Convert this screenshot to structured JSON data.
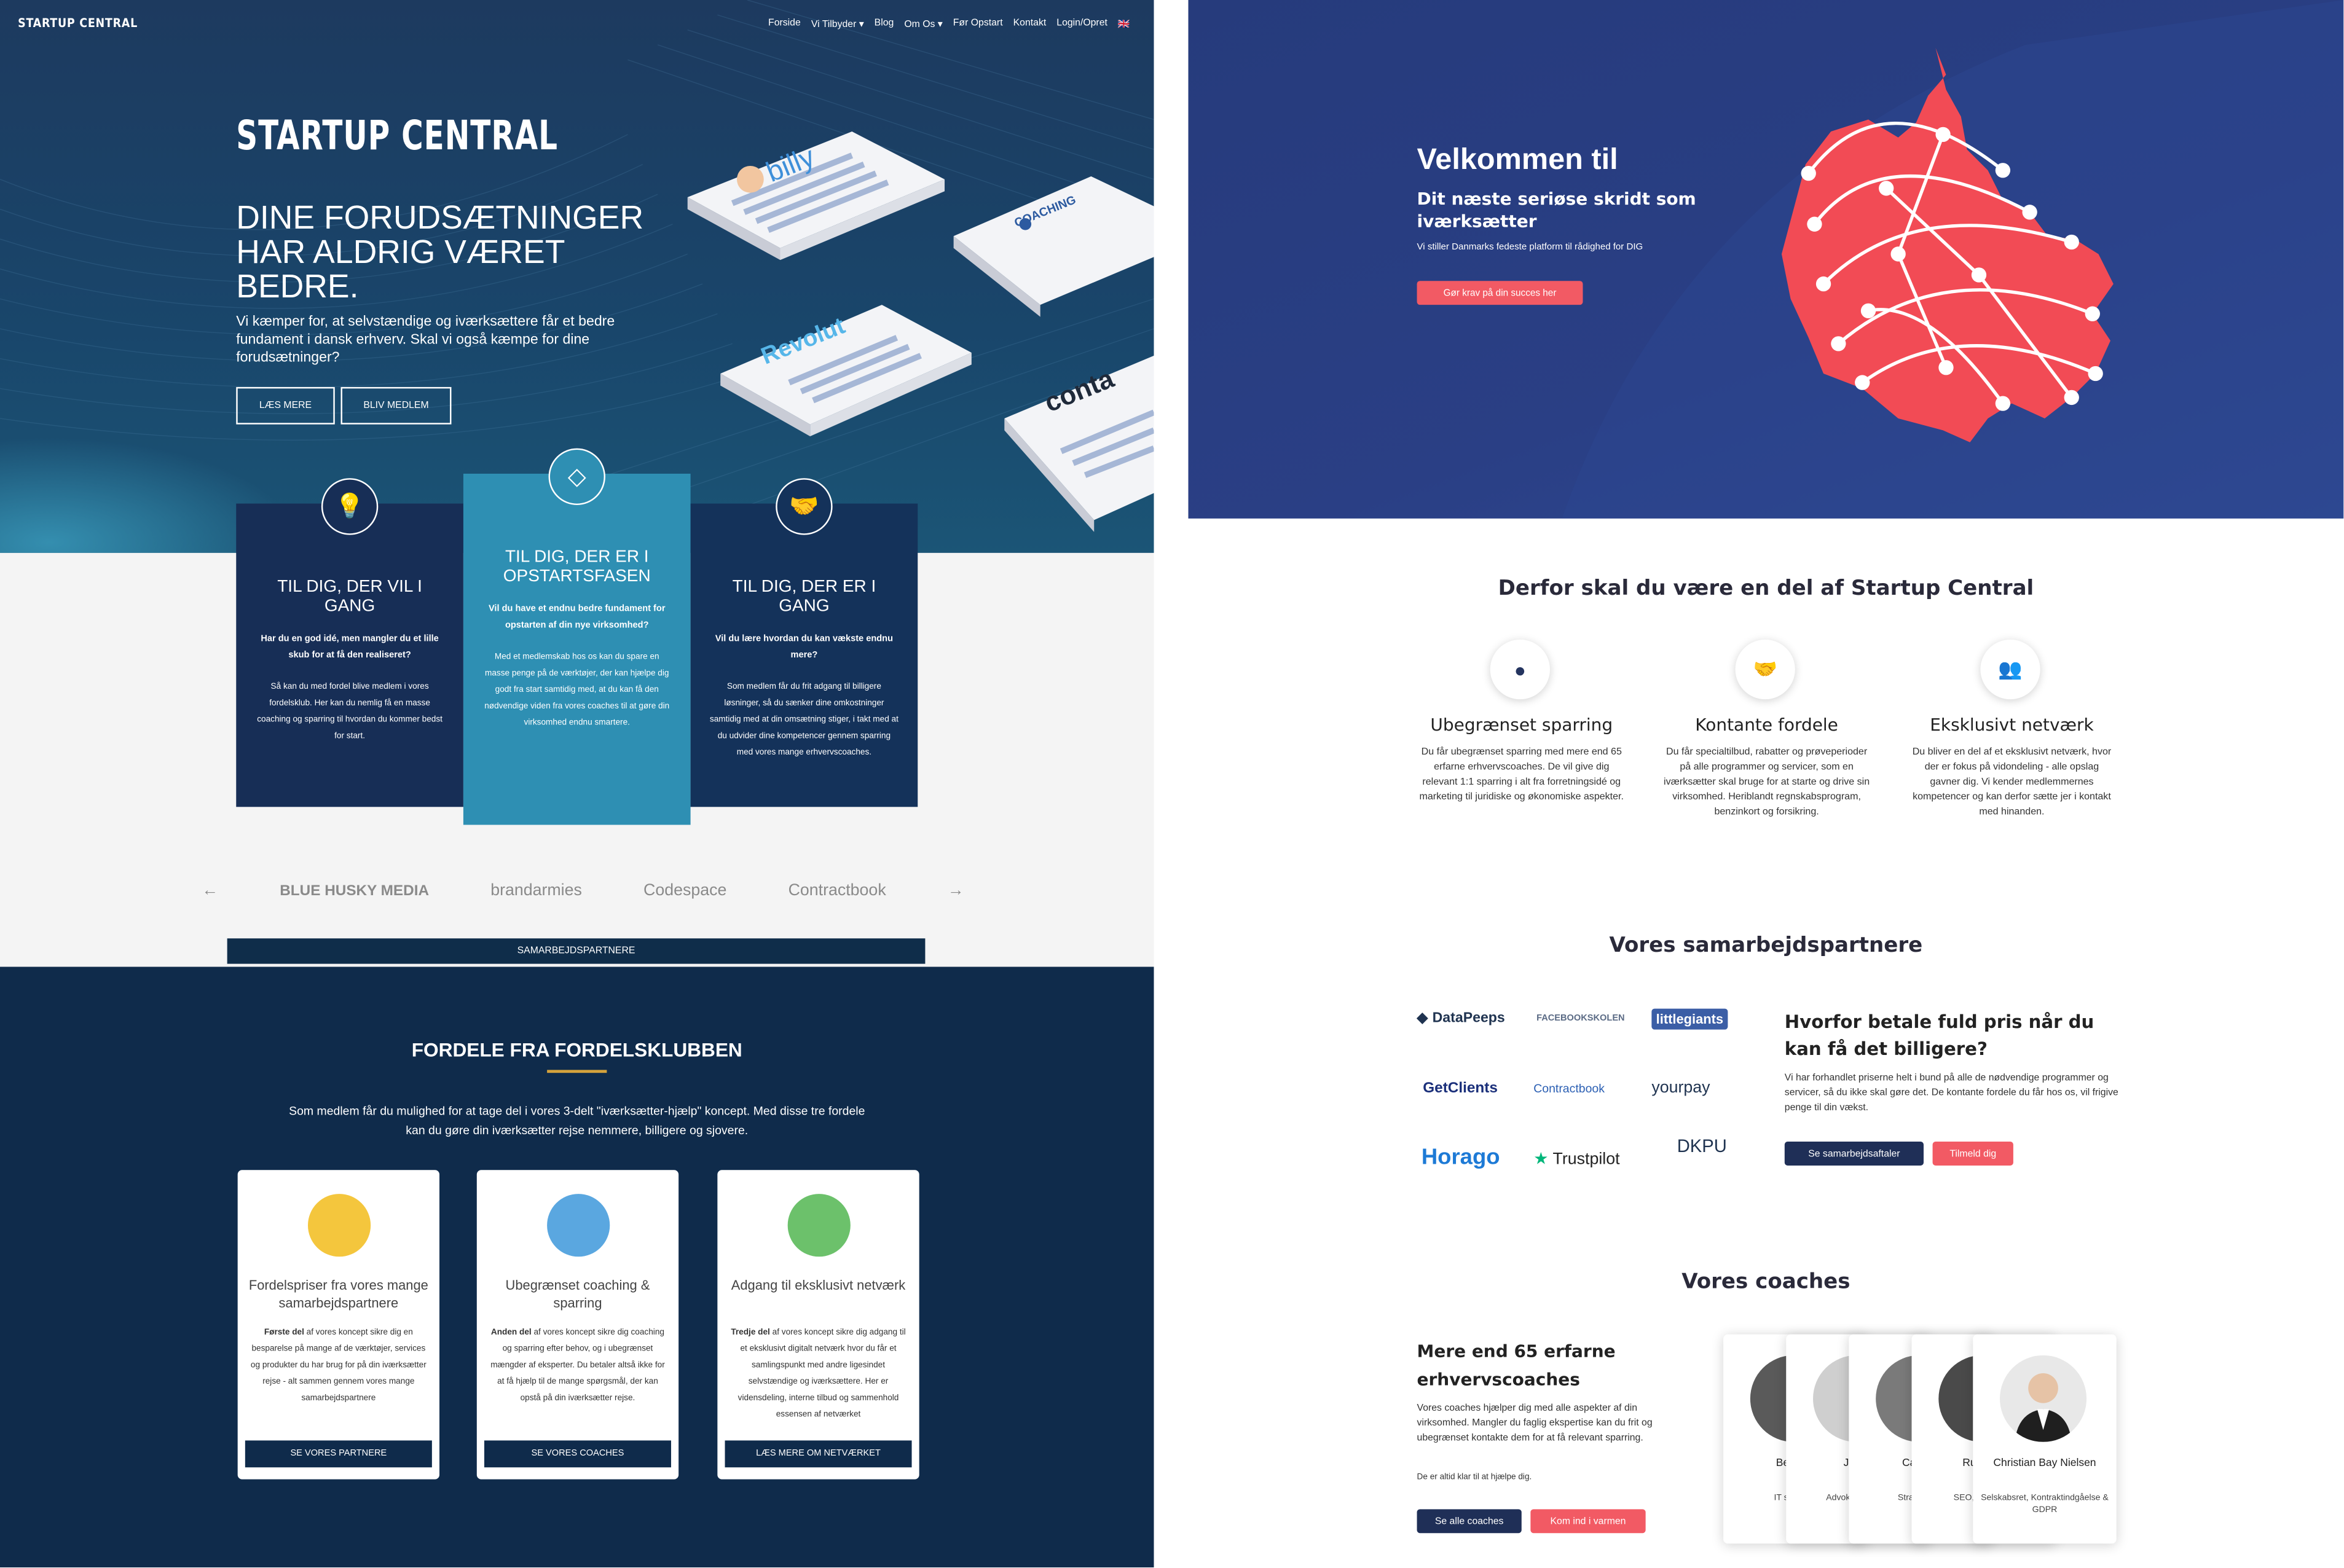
{
  "nav": {
    "logo": "STARTUP CENTRAL",
    "items": [
      "Forside",
      "Vi Tilbyder ▾",
      "Blog",
      "Om Os ▾",
      "Før Opstart",
      "Kontakt",
      "Login/Opret",
      "🇬🇧"
    ]
  },
  "hero": {
    "logo": "STARTUP CENTRAL",
    "headline": "DINE FORUDSÆTNINGER HAR ALDRIG VÆRET BEDRE.",
    "text": "Vi kæmper for, at selvstændige og iværksættere får et bedre fundament i dansk erhverv. Skal vi også kæmpe for dine forudsætninger?",
    "btn_read": "LÆS MERE",
    "btn_member": "BLIV MEDLEM",
    "cards": [
      "billy",
      "COACHING",
      "Revolut",
      "conta"
    ]
  },
  "audience": [
    {
      "title": "TIL DIG, DER VIL I GANG",
      "question": "Har du en god idé, men mangler du et lille skub for at få den realiseret?",
      "body": "Så kan du med fordel blive medlem i vores fordelsklub. Her kan du nemlig få en masse coaching og sparring til hvordan du kommer bedst for start."
    },
    {
      "title": "TIL DIG, DER ER I OPSTARTSFASEN",
      "question": "Vil du have et endnu bedre fundament for opstarten af din nye virksomhed?",
      "body": "Med et medlemskab hos os kan du spare en masse penge på de værktøjer, der kan hjælpe dig godt fra start samtidig med, at du kan få den nødvendige viden fra vores coaches til at gøre din virksomhed endnu smartere."
    },
    {
      "title": "TIL DIG, DER ER I GANG",
      "question": "Vil du lære hvordan du kan vækste endnu mere?",
      "body": "Som medlem får du frit adgang til billigere løsninger, så du sænker dine omkostninger samtidig med at din omsætning stiger, i takt med at du udvider dine kompetencer gennem sparring med vores mange erhvervscoaches."
    }
  ],
  "partners_row": {
    "prev": "←",
    "next": "→",
    "logos": [
      "BLUE HUSKY MEDIA",
      "brandarmies",
      "Codespace",
      "Contractbook"
    ],
    "button": "SAMARBEJDSPARTNERE"
  },
  "fordele": {
    "title": "FORDELE FRA FORDELSKLUBBEN",
    "intro": "Som medlem får du mulighed for at tage del i vores 3-delt \"iværksætter-hjælp\" koncept. Med disse tre fordele kan du gøre din iværksætter rejse nemmere, billigere og sjovere.",
    "cards": [
      {
        "title": "Fordelspriser fra vores mange samarbejdspartnere",
        "lead": "Første del",
        "body": " af vores koncept sikre dig en besparelse på mange af de værktøjer, services og produkter du har brug for på din iværksætter rejse - alt sammen gennem vores mange samarbejdspartnere",
        "button": "SE VORES PARTNERE"
      },
      {
        "title": "Ubegrænset coaching & sparring",
        "lead": "Anden del",
        "body": " af vores koncept sikre dig coaching og sparring efter behov, og i ubegrænset mængder af eksperter. Du betaler altså ikke for at få hjælp til de mange spørgsmål, der kan opstå på din iværksætter rejse.",
        "button": "SE VORES COACHES"
      },
      {
        "title": "Adgang til eksklusivt netværk",
        "lead": "Tredje del",
        "body": " af vores koncept sikre dig adgang til et eksklusivt digitalt netværk hvor du får et samlingspunkt med andre ligesindet selvstændige og iværksættere. Her er vidensdeling, interne tilbud og sammenhold essensen af netværket",
        "button": "LÆS MERE OM NETVÆRKET"
      }
    ]
  },
  "right_hero": {
    "title": "Velkommen til",
    "subtitle": "Dit næste seriøse skridt som iværksætter",
    "text": "Vi stiller Danmarks fedeste platform til rådighed for DIG",
    "button": "Gør krav på din succes her",
    "map_color": "#f24b55"
  },
  "why": {
    "title": "Derfor skal du være en del af Startup Central",
    "features": [
      {
        "icon": "person-icon",
        "title": "Ubegrænset sparring",
        "text": "Du får ubegrænset sparring med mere end 65 erfarne erhvervscoaches. De vil give dig relevant 1:1 sparring i alt fra forretningsidé og marketing til juridiske og økonomiske aspekter."
      },
      {
        "icon": "handshake-icon",
        "title": "Kontante fordele",
        "text": "Du får specialtilbud, rabatter og prøveperioder på alle programmer og servicer, som en iværksætter skal bruge for at starte og drive sin virksomhed. Heriblandt regnskabsprogram, benzinkort og forsikring."
      },
      {
        "icon": "people-icon",
        "title": "Eksklusivt netværk",
        "text": "Du bliver en del af et eksklusivt netværk, hvor der er fokus på vidondeling - alle opslag gavner dig. Vi kender medlemmernes kompetencer og kan derfor sætte jer i kontakt med hinanden."
      }
    ]
  },
  "partners": {
    "title": "Vores samarbejdspartnere",
    "logos": [
      "DataPeeps",
      "FACEBOOKSKOLEN",
      "littlegiants",
      "GetClients",
      "Contractbook",
      "yourpay",
      "Horago",
      "Trustpilot",
      "DKPU"
    ],
    "why_title": "Hvorfor betale fuld pris når du kan få det billigere?",
    "why_text": "Vi har forhandlet priserne helt i bund på alle de nødvendige programmer og servicer, så du ikke skal gøre det. De kontante fordele du får hos os, vil frigive penge til din vækst.",
    "btn_agreements": "Se samarbejdsaftaler",
    "btn_signup": "Tilmeld dig"
  },
  "coaches": {
    "title": "Vores coaches",
    "heading": "Mere end 65 erfarne erhvervscoaches",
    "text": "Vores coaches hjælper dig med alle aspekter af din virksomhed. Mangler du faglig ekspertise kan du frit og ubegrænset kontakte dem for at få relevant sparring.",
    "text2": "De er altid klar til at hjælpe dig.",
    "btn_all": "Se alle coaches",
    "btn_join": "Kom ind i varmen",
    "cards": [
      {
        "name": "Benn Ni",
        "role": "IT sikkerhe"
      },
      {
        "name": "Jonas",
        "role": "Advokat Inkasso"
      },
      {
        "name": "Cam Je",
        "role": "Strategi Pro"
      },
      {
        "name": "Ruben S",
        "role": "SEO, Ads, Ivær"
      },
      {
        "name": "Christian Bay Nielsen",
        "role": "Selskabsret, Kontraktindgåelse & GDPR"
      }
    ]
  }
}
